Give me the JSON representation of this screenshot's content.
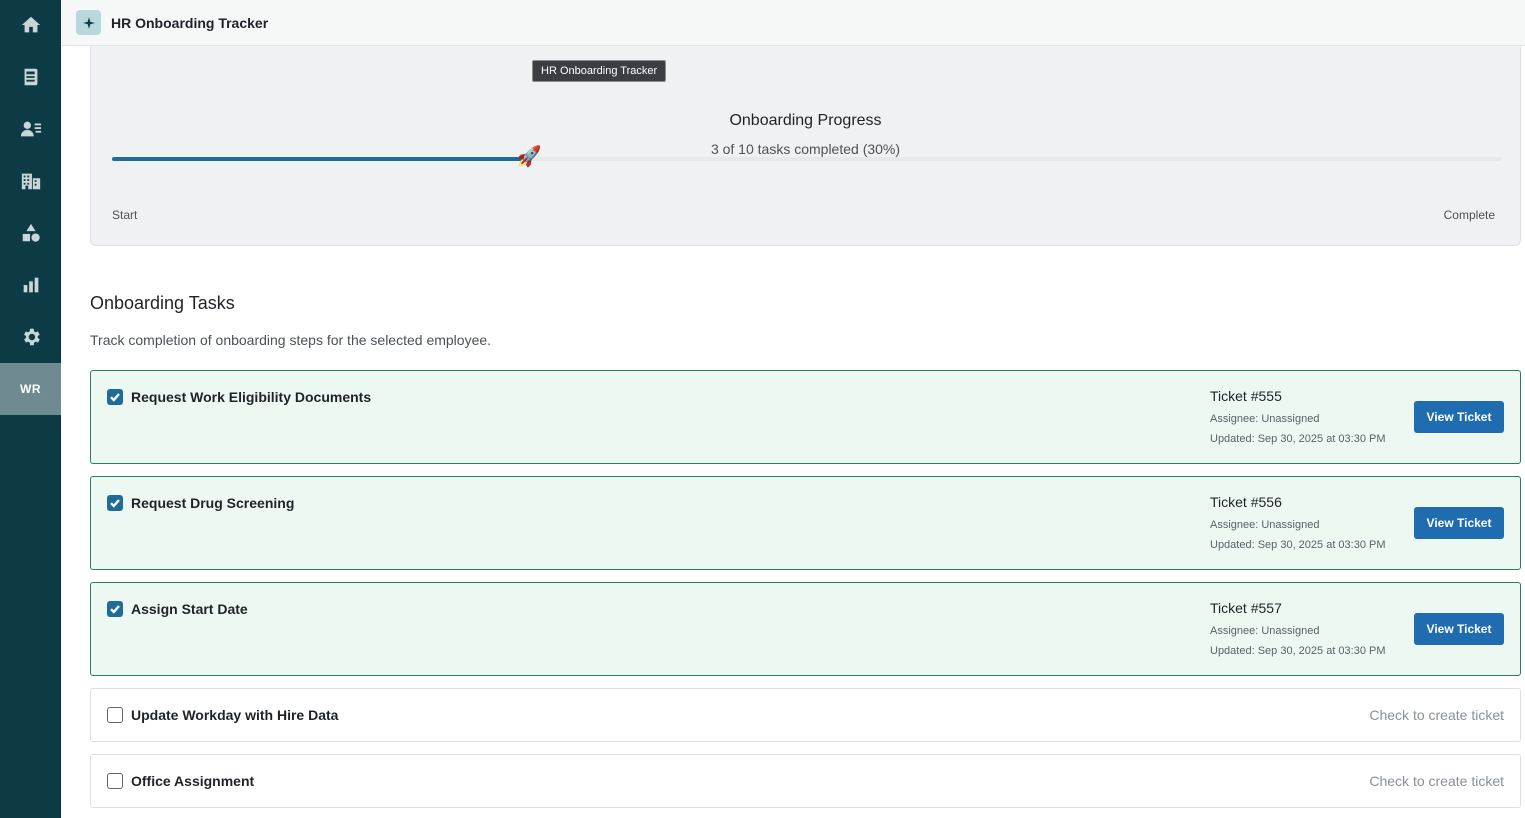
{
  "sidebar": {
    "icons": [
      "home-icon",
      "book-icon",
      "people-list-icon",
      "building-icon",
      "shapes-icon",
      "bar-chart-icon",
      "gear-icon"
    ],
    "user_initials": "WR"
  },
  "header": {
    "title": "HR Onboarding Tracker"
  },
  "progress": {
    "tooltip": "HR Onboarding Tracker",
    "title": "Onboarding Progress",
    "subtitle": "3 of 10 tasks completed (30%)",
    "completed": 3,
    "total": 10,
    "percent": 30,
    "start_label": "Start",
    "end_label": "Complete",
    "marker": "🚀"
  },
  "section": {
    "title": "Onboarding Tasks",
    "description": "Track completion of onboarding steps for the selected employee."
  },
  "tasks": [
    {
      "name": "Request Work Eligibility Documents",
      "checked": true,
      "ticket": "Ticket #555",
      "assignee": "Assignee: Unassigned",
      "updated": "Updated: Sep 30, 2025 at 03:30 PM",
      "button": "View Ticket"
    },
    {
      "name": "Request Drug Screening",
      "checked": true,
      "ticket": "Ticket #556",
      "assignee": "Assignee: Unassigned",
      "updated": "Updated: Sep 30, 2025 at 03:30 PM",
      "button": "View Ticket"
    },
    {
      "name": "Assign Start Date",
      "checked": true,
      "ticket": "Ticket #557",
      "assignee": "Assignee: Unassigned",
      "updated": "Updated: Sep 30, 2025 at 03:30 PM",
      "button": "View Ticket"
    },
    {
      "name": "Update Workday with Hire Data",
      "checked": false,
      "hint": "Check to create ticket"
    },
    {
      "name": "Office Assignment",
      "checked": false,
      "hint": "Check to create ticket"
    }
  ]
}
